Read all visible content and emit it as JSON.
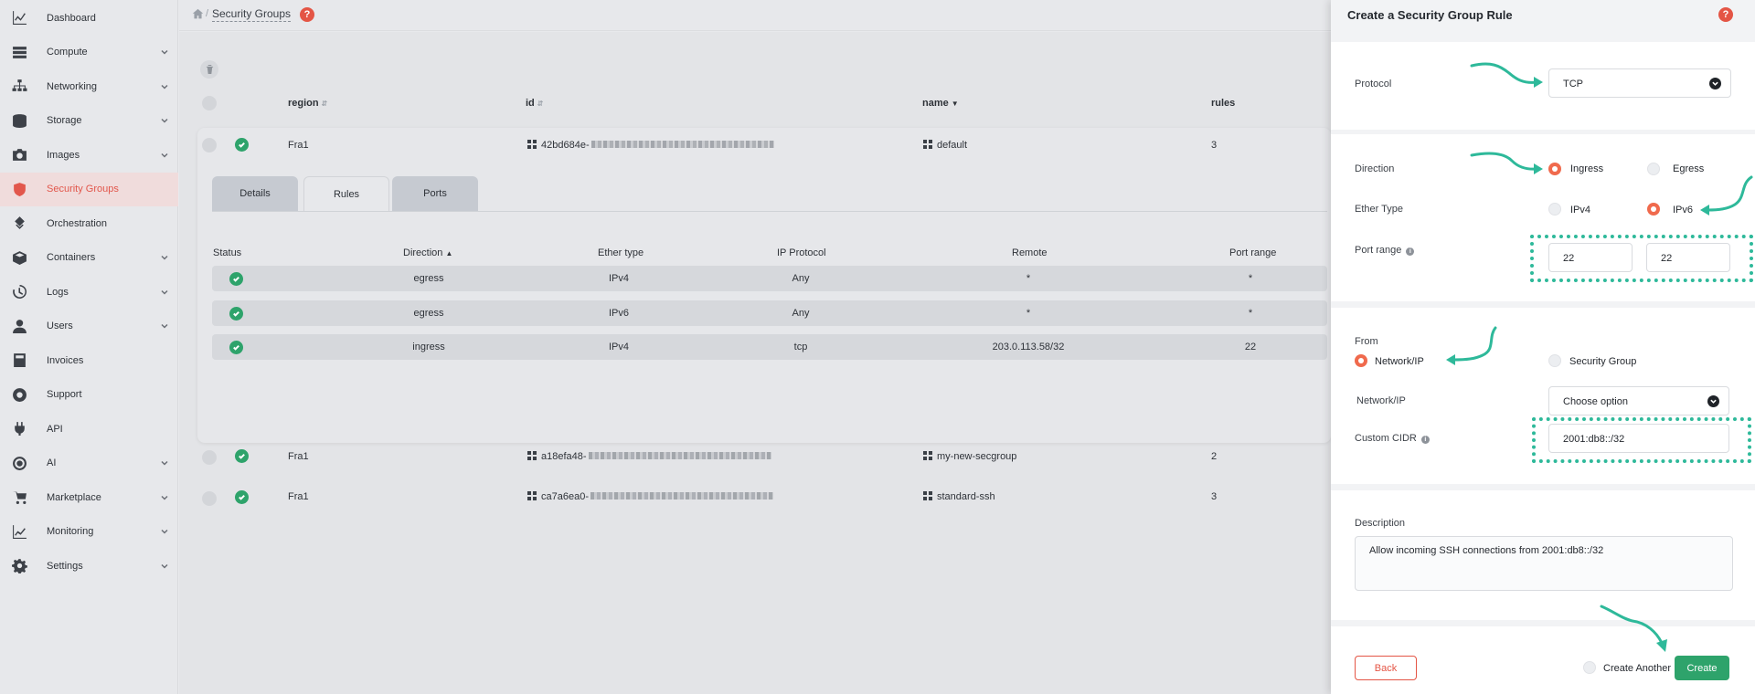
{
  "sidebar": {
    "items": [
      {
        "label": "Dashboard",
        "icon": "chart-icon",
        "has_chevron": false,
        "active": false
      },
      {
        "label": "Compute",
        "icon": "server-icon",
        "has_chevron": true,
        "active": false
      },
      {
        "label": "Networking",
        "icon": "network-icon",
        "has_chevron": true,
        "active": false
      },
      {
        "label": "Storage",
        "icon": "database-icon",
        "has_chevron": true,
        "active": false
      },
      {
        "label": "Images",
        "icon": "camera-icon",
        "has_chevron": true,
        "active": false
      },
      {
        "label": "Security Groups",
        "icon": "shield-icon",
        "has_chevron": false,
        "active": true
      },
      {
        "label": "Orchestration",
        "icon": "orchestration-icon",
        "has_chevron": false,
        "active": false
      },
      {
        "label": "Containers",
        "icon": "cube-icon",
        "has_chevron": true,
        "active": false
      },
      {
        "label": "Logs",
        "icon": "history-icon",
        "has_chevron": true,
        "active": false
      },
      {
        "label": "Users",
        "icon": "user-icon",
        "has_chevron": true,
        "active": false
      },
      {
        "label": "Invoices",
        "icon": "calculator-icon",
        "has_chevron": false,
        "active": false
      },
      {
        "label": "Support",
        "icon": "lifebuoy-icon",
        "has_chevron": false,
        "active": false
      },
      {
        "label": "API",
        "icon": "plug-icon",
        "has_chevron": false,
        "active": false
      },
      {
        "label": "AI",
        "icon": "ai-icon",
        "has_chevron": true,
        "active": false
      },
      {
        "label": "Marketplace",
        "icon": "cart-icon",
        "has_chevron": true,
        "active": false
      },
      {
        "label": "Monitoring",
        "icon": "monitoring-icon",
        "has_chevron": true,
        "active": false
      },
      {
        "label": "Settings",
        "icon": "gear-icon",
        "has_chevron": true,
        "active": false
      }
    ]
  },
  "breadcrumb": {
    "current": "Security Groups"
  },
  "table": {
    "headers": {
      "region": "region",
      "id": "id",
      "name": "name",
      "rules": "rules"
    },
    "rows": [
      {
        "region": "Fra1",
        "id_prefix": "42bd684e-",
        "name": "default",
        "rules": "3"
      },
      {
        "region": "Fra1",
        "id_prefix": "a18efa48-",
        "name": "my-new-secgroup",
        "rules": "2"
      },
      {
        "region": "Fra1",
        "id_prefix": "ca7a6ea0-",
        "name": "standard-ssh",
        "rules": "3"
      }
    ]
  },
  "tabs": [
    "Details",
    "Rules",
    "Ports"
  ],
  "rules_table": {
    "headers": [
      "Status",
      "Direction",
      "Ether type",
      "IP Protocol",
      "Remote",
      "Port range"
    ],
    "rows": [
      {
        "direction": "egress",
        "ether_type": "IPv4",
        "protocol": "Any",
        "remote": "*",
        "port_range": "*"
      },
      {
        "direction": "egress",
        "ether_type": "IPv6",
        "protocol": "Any",
        "remote": "*",
        "port_range": "*"
      },
      {
        "direction": "ingress",
        "ether_type": "IPv4",
        "protocol": "tcp",
        "remote": "203.0.113.58/32",
        "port_range": "22"
      }
    ]
  },
  "panel": {
    "title": "Create a Security Group Rule",
    "protocol_label": "Protocol",
    "protocol_value": "TCP",
    "direction_label": "Direction",
    "direction_options": [
      "Ingress",
      "Egress"
    ],
    "ether_type_label": "Ether Type",
    "ether_type_options": [
      "IPv4",
      "IPv6"
    ],
    "port_range_label": "Port range",
    "port_from": "22",
    "port_to": "22",
    "from_label": "From",
    "from_options": [
      "Network/IP",
      "Security Group"
    ],
    "network_ip_label": "Network/IP",
    "network_ip_value": "Choose option",
    "custom_cidr_label": "Custom CIDR",
    "custom_cidr_value": "2001:db8::/32",
    "description_label": "Description",
    "description_value": "Allow incoming SSH connections from 2001:db8::/32",
    "back_label": "Back",
    "create_another_label": "Create Another",
    "create_label": "Create"
  },
  "colors": {
    "accent": "#e45545",
    "success": "#2ea36b",
    "annotation": "#2eb99a"
  }
}
